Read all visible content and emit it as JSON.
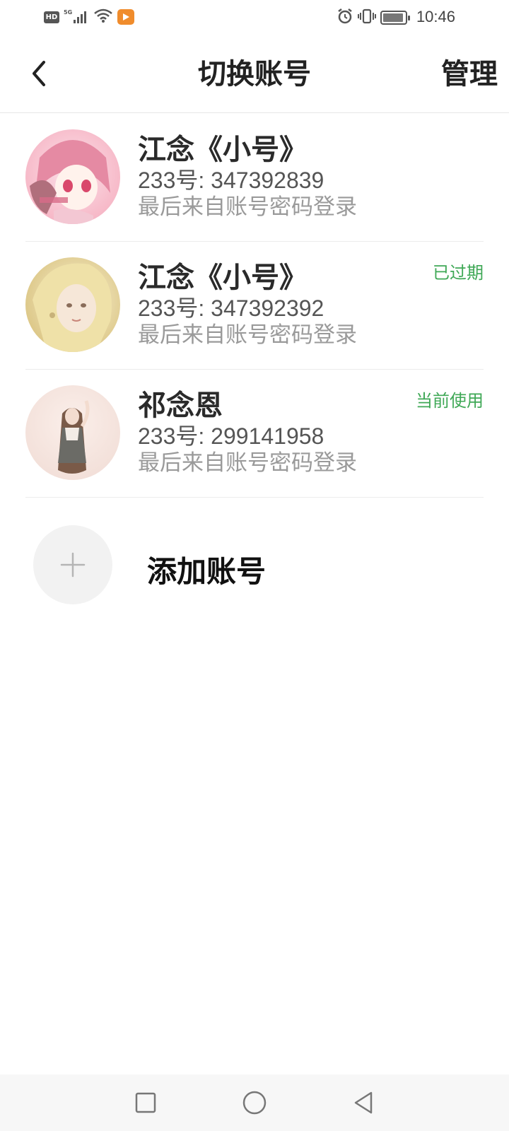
{
  "status_bar": {
    "hd_label": "HD",
    "network_label": "5G",
    "time": "10:46",
    "icons": [
      "hd-icon",
      "signal-icon",
      "wifi-icon",
      "app-notification-icon",
      "alarm-icon",
      "vibrate-icon",
      "battery-icon"
    ]
  },
  "header": {
    "back_icon": "chevron-left-icon",
    "title": "切换账号",
    "manage_label": "管理"
  },
  "accounts": [
    {
      "name": "江念《小号》",
      "id_text": "233号: 347392839",
      "login_text": "最后来自账号密码登录",
      "status": "",
      "avatar_palette": [
        "#f6b3c3",
        "#fbe2ea",
        "#e58aa3"
      ]
    },
    {
      "name": "江念《小号》",
      "id_text": "233号: 347392392",
      "login_text": "最后来自账号密码登录",
      "status": "已过期",
      "avatar_palette": [
        "#efe1a8",
        "#f8f1d6",
        "#d9c27d"
      ]
    },
    {
      "name": "祁念恩",
      "id_text": "233号: 299141958",
      "login_text": "最后来自账号密码登录",
      "status": "当前使用",
      "avatar_palette": [
        "#f1ddd6",
        "#fbefea",
        "#7a5a48"
      ]
    }
  ],
  "add_account": {
    "label": "添加账号",
    "icon": "plus-icon"
  },
  "colors": {
    "accent_green": "#3fa856",
    "text_primary": "#2a2a2a",
    "text_secondary": "#555555",
    "text_muted": "#9a9a9a",
    "divider": "#ececec"
  },
  "nav_bar": {
    "icons": [
      "recent-apps-icon",
      "home-icon",
      "back-triangle-icon"
    ]
  }
}
